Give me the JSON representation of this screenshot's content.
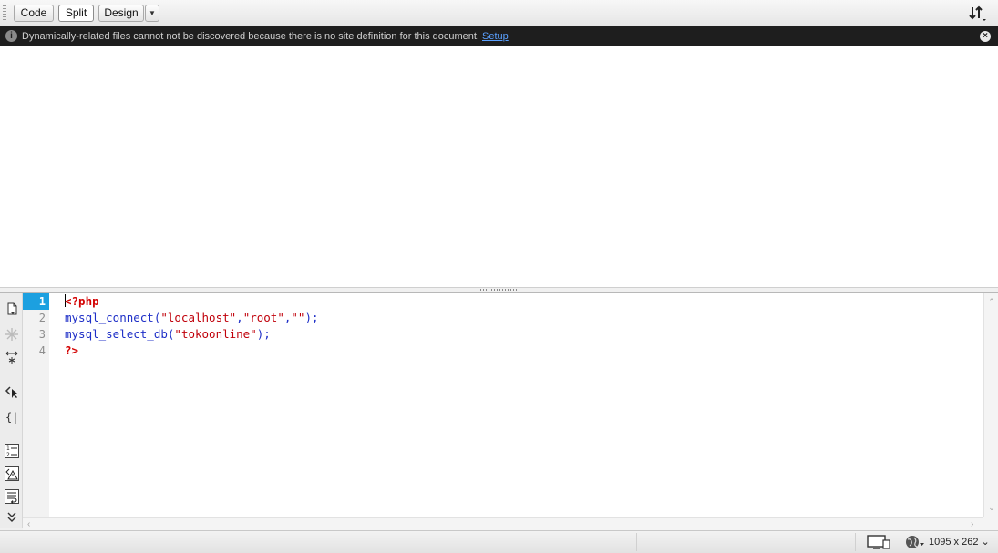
{
  "toolbar": {
    "buttons": [
      {
        "label": "Code",
        "active": false
      },
      {
        "label": "Split",
        "active": true
      },
      {
        "label": "Design",
        "active": false
      }
    ],
    "dropdown_glyph": "▼",
    "right_icon": "sort-icon"
  },
  "infobar": {
    "message": "Dynamically-related files cannot not be discovered because there is no site definition for this document.",
    "link_label": "Setup",
    "info_glyph": "i",
    "close_glyph": "×"
  },
  "code_view": {
    "line_numbers": [
      "1",
      "2",
      "3",
      "4"
    ],
    "current_line": "1",
    "lines": [
      {
        "segments": [
          {
            "text": "<?php",
            "kind": "php-tag"
          }
        ]
      },
      {
        "segments": [
          {
            "text": "mysql_connect(",
            "kind": "fn"
          },
          {
            "text": "\"localhost\"",
            "kind": "str"
          },
          {
            "text": ",",
            "kind": "fn"
          },
          {
            "text": "\"root\"",
            "kind": "str"
          },
          {
            "text": ",",
            "kind": "fn"
          },
          {
            "text": "\"\"",
            "kind": "str"
          },
          {
            "text": ");",
            "kind": "fn"
          }
        ]
      },
      {
        "segments": [
          {
            "text": "mysql_select_db(",
            "kind": "fn"
          },
          {
            "text": "\"tokoonline\"",
            "kind": "str"
          },
          {
            "text": ");",
            "kind": "fn"
          }
        ]
      },
      {
        "segments": [
          {
            "text": "?>",
            "kind": "php-tag"
          }
        ]
      }
    ],
    "colors": {
      "php_tag": "#d30000",
      "function": "#1e2fc7",
      "string": "#c0000a",
      "current_line": "#1ca0e0"
    }
  },
  "status_bar": {
    "size_label": "1095 x 262",
    "size_dropdown_glyph": "⌄"
  }
}
